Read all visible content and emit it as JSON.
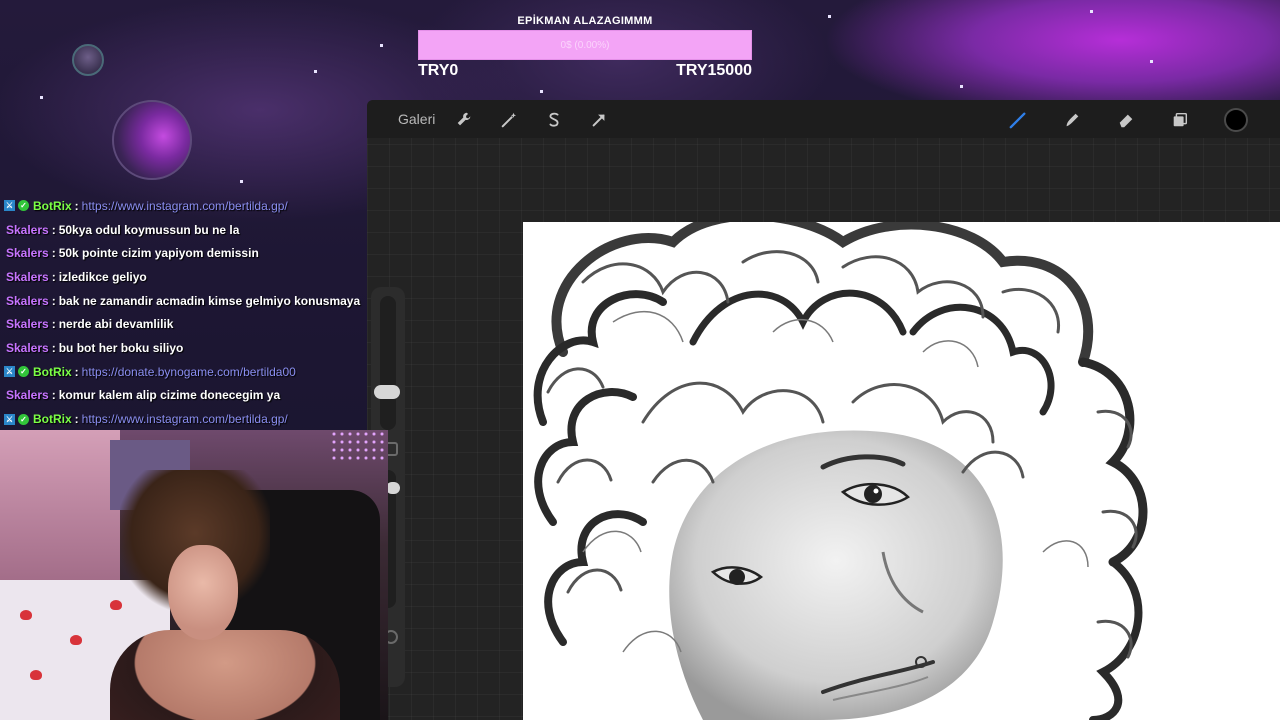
{
  "goal": {
    "title": "EPİKMAN ALAZAGIMMM",
    "bar_text": "0$ (0.00%)",
    "progress": 0.0,
    "min_label": "TRY0",
    "max_label": "TRY15000",
    "colors": {
      "bar": "#f3a4f6",
      "text": "#ffffff"
    }
  },
  "procreate": {
    "gallery_label": "Galeri",
    "tools_left": [
      "wrench-icon",
      "magic-wand-icon",
      "selection-icon",
      "transform-icon"
    ],
    "tools_right": [
      "brush-icon",
      "smudge-icon",
      "eraser-icon",
      "layers-icon",
      "color-swatch"
    ],
    "active_color": "#000000"
  },
  "chat": {
    "messages": [
      {
        "user": "BotRix",
        "type": "bot",
        "text": "https://www.instagram.com/bertilda.gp/",
        "is_link": true
      },
      {
        "user": "Skalers",
        "type": "user",
        "text": "50kya odul koymussun bu ne la",
        "is_link": false
      },
      {
        "user": "Skalers",
        "type": "user",
        "text": "50k pointe cizim yapiyom demissin",
        "is_link": false
      },
      {
        "user": "Skalers",
        "type": "user",
        "text": "izledikce geliyo",
        "is_link": false
      },
      {
        "user": "Skalers",
        "type": "user",
        "text": "bak ne zamandir acmadin kimse gelmiyo konusmaya",
        "is_link": false
      },
      {
        "user": "Skalers",
        "type": "user",
        "text": "nerde abi devamlilik",
        "is_link": false
      },
      {
        "user": "Skalers",
        "type": "user",
        "text": "bu bot her boku siliyo",
        "is_link": false
      },
      {
        "user": "BotRix",
        "type": "bot",
        "text": "https://donate.bynogame.com/bertilda00",
        "is_link": true
      },
      {
        "user": "Skalers",
        "type": "user",
        "text": "komur kalem alip cizime donecegim ya",
        "is_link": false
      },
      {
        "user": "BotRix",
        "type": "bot",
        "text": "https://www.instagram.com/bertilda.gp/",
        "is_link": true
      }
    ],
    "separator": ":",
    "colors": {
      "bot": "#7bff46",
      "user": "#c774ff",
      "link": "#8a8ef0"
    }
  }
}
